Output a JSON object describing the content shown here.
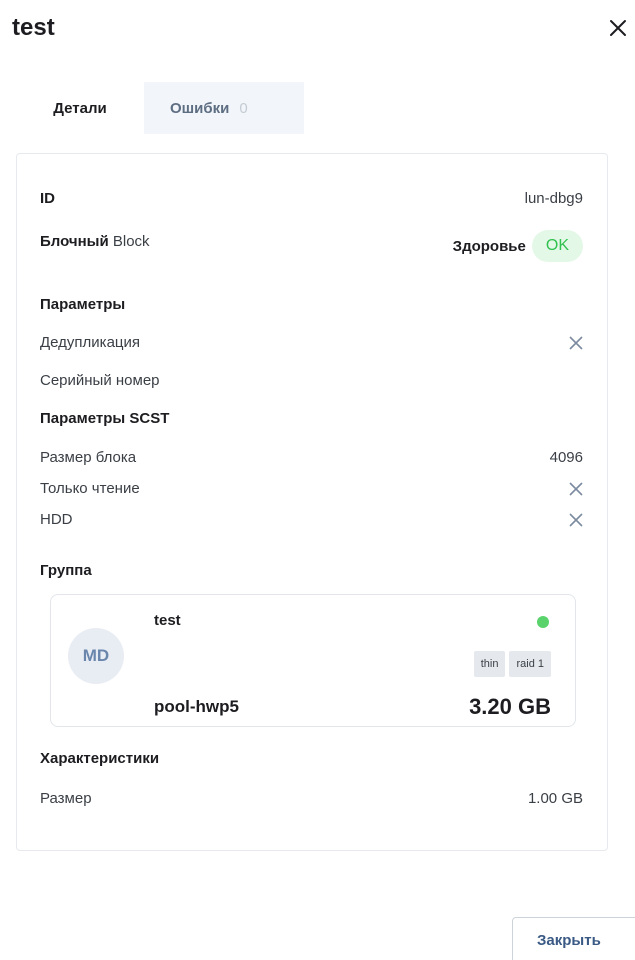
{
  "modal": {
    "title": "test",
    "close_button_label": "Закрыть"
  },
  "tabs": [
    {
      "label": "Детали",
      "active": true
    },
    {
      "label": "Ошибки",
      "count": "0",
      "active": false
    }
  ],
  "details": {
    "id_label": "ID",
    "id_value": "lun-dbg9",
    "type_bold": "Блочный",
    "type_rest": " Block",
    "health_label": "Здоровье",
    "health_status": "OK",
    "params_heading": "Параметры",
    "dedup_label": "Дедупликация",
    "serial_label": "Серийный номер",
    "scst_heading": "Параметры SCST",
    "block_size_label": "Размер блока",
    "block_size_value": "4096",
    "readonly_label": "Только чтение",
    "hdd_label": "HDD",
    "group_heading": "Группа",
    "chars_heading": "Характеристики",
    "size_label": "Размер",
    "size_value": "1.00 GB"
  },
  "pool": {
    "avatar": "MD",
    "name": "test",
    "tags": [
      "thin",
      "raid 1"
    ],
    "id": "pool-hwp5",
    "size": "3.20 GB",
    "status_color": "#5ad36d"
  },
  "icons": {
    "close": "close-icon",
    "false_mark": "x-mark-icon"
  },
  "colors": {
    "ok_bg": "#e4f8e8",
    "ok_text": "#31c14f",
    "tab_inactive_bg": "#f2f6fa"
  }
}
